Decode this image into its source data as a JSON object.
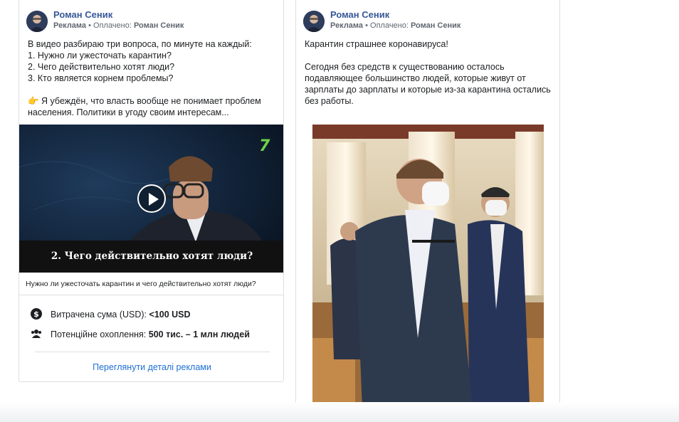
{
  "ads": [
    {
      "advertiser": "Роман Сеник",
      "meta": {
        "label": "Реклама",
        "separator": " • ",
        "paid_prefix": "Оплачено: ",
        "paid_by": "Роман Сеник"
      },
      "text_lines": [
        "В видео разбираю три вопроса, по минуте на каждый:",
        "1. Нужно ли ужесточать карантин?",
        "2. Чего действительно хотят люди?",
        "3. Кто является корнем проблемы?",
        "",
        "👉 Я убеждён, что власть вообще не понимает проблем",
        "населения. Политики в угоду своим интересам..."
      ],
      "video_caption": "2. Чего действительно хотят люди?",
      "channel_logo": "7",
      "link_caption": "Нужно ли ужесточать карантин и чего действительно хотят люди?",
      "spend": {
        "label": "Витрачена сума (USD): ",
        "value": "<100 USD",
        "icon": "dollar-icon"
      },
      "reach": {
        "label": "Потенційне охоплення: ",
        "value": "500 тис. – 1 млн людей",
        "icon": "people-icon"
      },
      "details_link": "Переглянути деталі реклами"
    },
    {
      "advertiser": "Роман Сеник",
      "meta": {
        "label": "Реклама",
        "separator": " • ",
        "paid_prefix": "Оплачено: ",
        "paid_by": "Роман Сеник"
      },
      "text_lines": [
        "Карантин страшнее коронавируса!",
        "",
        "Сегодня без средств к существованию осталось",
        "подавляющее большинство людей, которые живут от",
        "зарплаты до зарплаты и которые из-за карантина остались",
        "без работы."
      ]
    }
  ],
  "colors": {
    "link": "#1d6fd6",
    "name": "#385898",
    "border": "#dddfe2"
  }
}
